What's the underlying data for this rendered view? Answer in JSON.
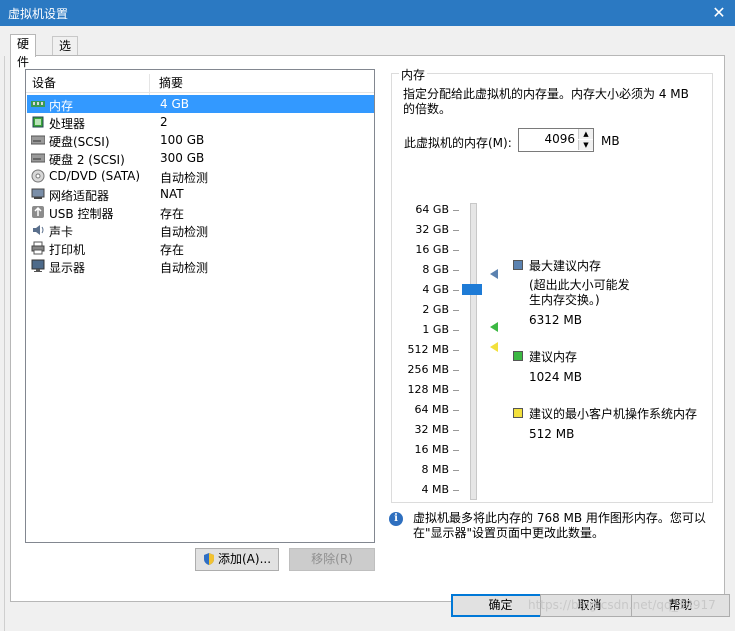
{
  "window": {
    "title": "虚拟机设置",
    "close_glyph": "✕"
  },
  "tabs": [
    {
      "label": "硬件"
    },
    {
      "label": "选项"
    }
  ],
  "device_list": {
    "headers": {
      "device": "设备",
      "summary": "摘要"
    },
    "rows": [
      {
        "name": "内存",
        "summary": "4 GB",
        "icon": "memory-icon"
      },
      {
        "name": "处理器",
        "summary": "2",
        "icon": "cpu-icon"
      },
      {
        "name": "硬盘(SCSI)",
        "summary": "100 GB",
        "icon": "hard-disk-icon"
      },
      {
        "name": "硬盘 2 (SCSI)",
        "summary": "300 GB",
        "icon": "hard-disk-icon"
      },
      {
        "name": "CD/DVD (SATA)",
        "summary": "自动检测",
        "icon": "cd-dvd-icon"
      },
      {
        "name": "网络适配器",
        "summary": "NAT",
        "icon": "network-adapter-icon"
      },
      {
        "name": "USB 控制器",
        "summary": "存在",
        "icon": "usb-icon"
      },
      {
        "name": "声卡",
        "summary": "自动检测",
        "icon": "sound-card-icon"
      },
      {
        "name": "打印机",
        "summary": "存在",
        "icon": "printer-icon"
      },
      {
        "name": "显示器",
        "summary": "自动检测",
        "icon": "monitor-icon"
      }
    ],
    "selected_index": 0
  },
  "buttons": {
    "add": "添加(A)...",
    "remove": "移除(R)",
    "ok": "确定",
    "cancel": "取消",
    "help": "帮助"
  },
  "memory": {
    "group_title": "内存",
    "description": "指定分配给此虚拟机的内存量。内存大小必须为 4 MB 的倍数。",
    "field_label": "此虚拟机的内存(M):",
    "value": "4096",
    "unit": "MB",
    "scale_ticks": [
      "64 GB",
      "32 GB",
      "16 GB",
      "8 GB",
      "4 GB",
      "2 GB",
      "1 GB",
      "512 MB",
      "256 MB",
      "128 MB",
      "64 MB",
      "32 MB",
      "16 MB",
      "8 MB",
      "4 MB"
    ],
    "legend": {
      "max": {
        "title": "最大建议内存",
        "note": "(超出此大小可能发生内存交换。)",
        "value": "6312 MB",
        "color": "#5b82b0"
      },
      "recommended": {
        "title": "建议内存",
        "value": "1024 MB",
        "color": "#3cb843"
      },
      "min_guest": {
        "title": "建议的最小客户机操作系统内存",
        "value": "512 MB",
        "color": "#f2e03c"
      }
    },
    "info_text": "虚拟机最多将此内存的 768 MB 用作图形内存。您可以在\"显示器\"设置页面中更改此数量。"
  },
  "watermark": "https://blog.csdn.net/qq_38917"
}
